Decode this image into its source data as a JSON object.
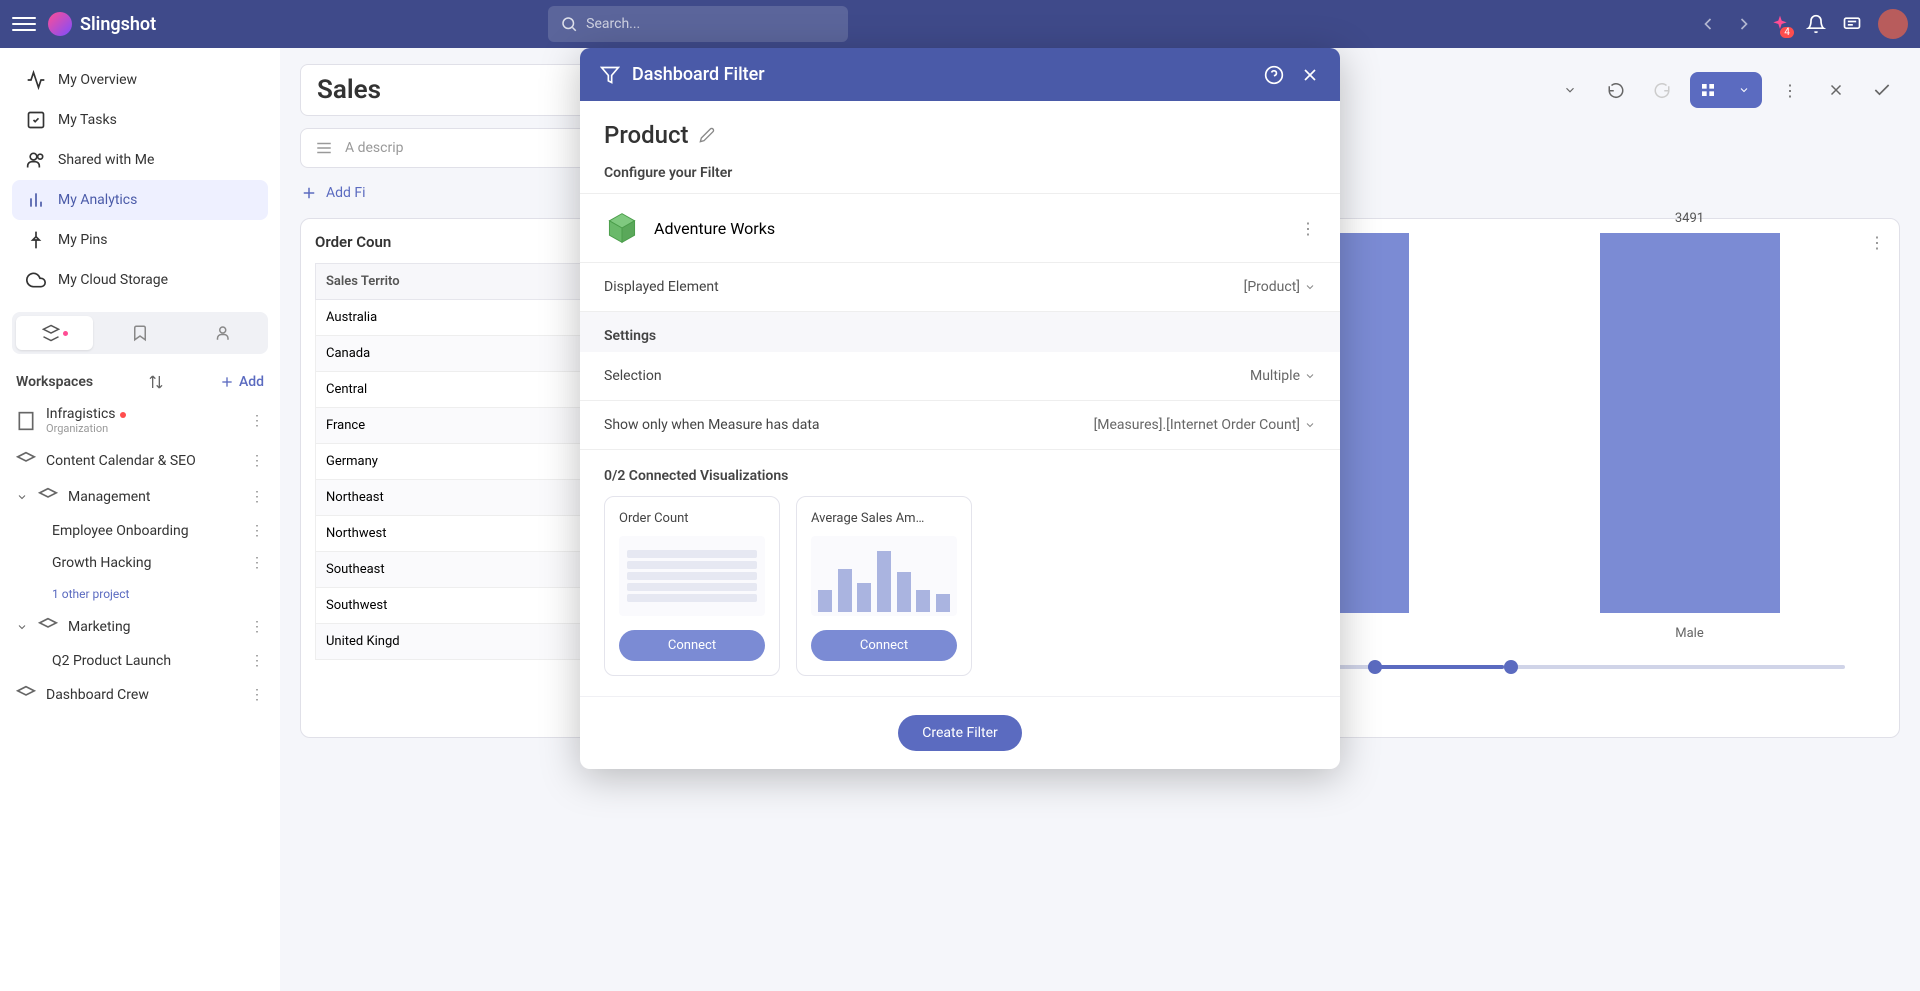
{
  "app": {
    "name": "Slingshot",
    "search_placeholder": "Search...",
    "notification_count": "4"
  },
  "sidebar": {
    "nav": [
      {
        "label": "My Overview",
        "icon": "activity"
      },
      {
        "label": "My Tasks",
        "icon": "check-square"
      },
      {
        "label": "Shared with Me",
        "icon": "users"
      },
      {
        "label": "My Analytics",
        "icon": "bar-chart",
        "active": true
      },
      {
        "label": "My Pins",
        "icon": "pin"
      },
      {
        "label": "My Cloud Storage",
        "icon": "cloud"
      }
    ],
    "workspaces_label": "Workspaces",
    "add_label": "Add",
    "org": {
      "name": "Infragistics",
      "subtitle": "Organization"
    },
    "items": [
      {
        "label": "Content Calendar & SEO"
      },
      {
        "label": "Management",
        "expanded": true,
        "children": [
          {
            "label": "Employee Onboarding"
          },
          {
            "label": "Growth Hacking"
          }
        ],
        "more": "1 other project"
      },
      {
        "label": "Marketing",
        "expanded": true,
        "children": [
          {
            "label": "Q2 Product Launch"
          }
        ]
      },
      {
        "label": "Dashboard Crew"
      }
    ]
  },
  "dashboard": {
    "title": "Sales",
    "description_placeholder": "A descrip",
    "add_filter_label": "Add Fi",
    "panels": {
      "order_count": {
        "title": "Order Coun",
        "header": "Sales Territo",
        "rows": [
          "Australia",
          "Canada",
          "Central",
          "France",
          "Germany",
          "Northeast",
          "Northwest",
          "Southeast",
          "Southwest",
          "United Kingd"
        ]
      },
      "avg_sales": {
        "bar_value": "3491",
        "x_label": "Male"
      }
    }
  },
  "modal": {
    "title": "Dashboard Filter",
    "filter_name": "Product",
    "configure_label": "Configure your Filter",
    "datasource": "Adventure Works",
    "displayed_element": {
      "label": "Displayed Element",
      "value": "[Product]"
    },
    "settings_label": "Settings",
    "selection": {
      "label": "Selection",
      "value": "Multiple"
    },
    "show_only": {
      "label": "Show only when Measure has data",
      "value": "[Measures].[Internet Order Count]"
    },
    "connected_viz_label": "0/2 Connected Visualizations",
    "viz": [
      {
        "title": "Order Count",
        "connect": "Connect"
      },
      {
        "title": "Average Sales Am…",
        "connect": "Connect"
      }
    ],
    "create_label": "Create Filter"
  },
  "chart_data": {
    "type": "bar",
    "categories": [
      "Male"
    ],
    "values": [
      3491
    ],
    "title": "",
    "xlabel": "",
    "ylabel": "",
    "ylim": [
      0,
      4000
    ]
  }
}
